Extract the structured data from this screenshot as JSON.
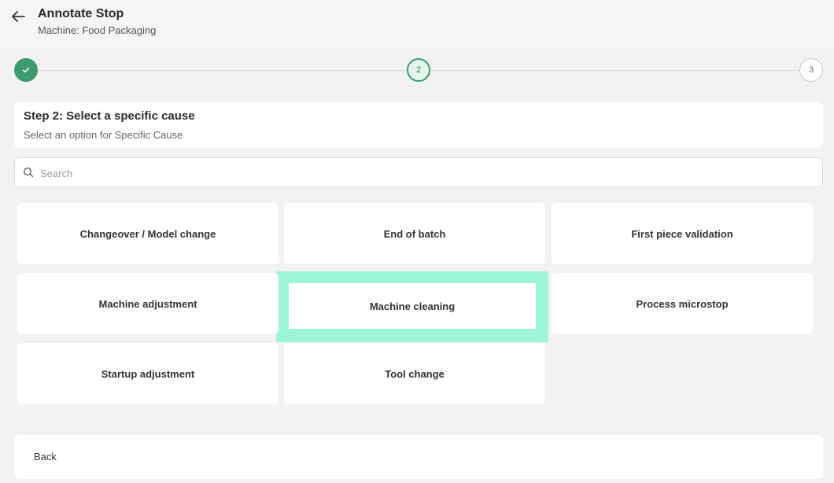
{
  "header": {
    "title": "Annotate Stop",
    "subtitle": "Machine: Food Packaging"
  },
  "stepper": {
    "steps": [
      {
        "label": "",
        "state": "done"
      },
      {
        "label": "2",
        "state": "current"
      },
      {
        "label": "3",
        "state": "next"
      }
    ]
  },
  "step": {
    "heading": "Step 2: Select a specific cause",
    "description": "Select an option for Specific Cause"
  },
  "search": {
    "placeholder": "Search",
    "value": ""
  },
  "options": [
    {
      "label": "Changeover / Model change"
    },
    {
      "label": "End of batch"
    },
    {
      "label": "First piece validation"
    },
    {
      "label": "Machine adjustment"
    },
    {
      "label": "Machine cleaning",
      "selected": true
    },
    {
      "label": "Process microstop"
    },
    {
      "label": "Startup adjustment"
    },
    {
      "label": "Tool change"
    }
  ],
  "footer": {
    "back_label": "Back"
  },
  "colors": {
    "accent": "#3d9a6f",
    "highlight": "#9bf5d6"
  }
}
